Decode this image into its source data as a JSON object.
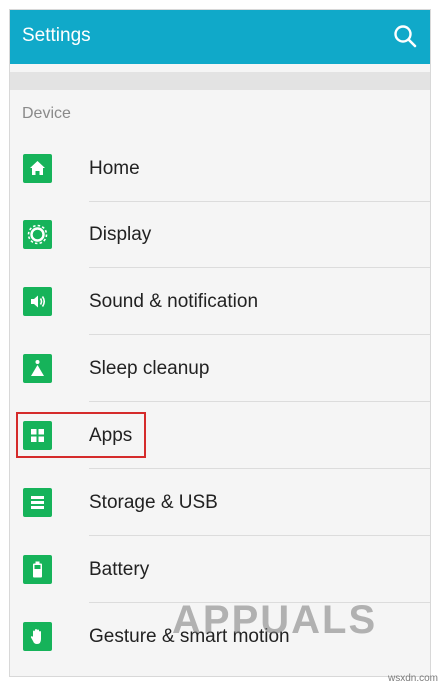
{
  "appbar": {
    "title": "Settings",
    "search_icon": "search-icon"
  },
  "section": {
    "label": "Device"
  },
  "items": [
    {
      "label": "Home",
      "icon": "home-icon"
    },
    {
      "label": "Display",
      "icon": "display-icon"
    },
    {
      "label": "Sound & notification",
      "icon": "sound-icon"
    },
    {
      "label": "Sleep cleanup",
      "icon": "sleep-cleanup-icon"
    },
    {
      "label": "Apps",
      "icon": "apps-icon",
      "highlighted": true
    },
    {
      "label": "Storage & USB",
      "icon": "storage-icon"
    },
    {
      "label": "Battery",
      "icon": "battery-icon"
    },
    {
      "label": "Gesture & smart motion",
      "icon": "gesture-icon"
    }
  ],
  "watermark": {
    "text": "APPUALS",
    "source": "wsxdn.com"
  },
  "colors": {
    "appbar": "#10a9c9",
    "icon_green": "#16b35a",
    "highlight_red": "#d52b2b",
    "background": "#f5f5f5"
  }
}
